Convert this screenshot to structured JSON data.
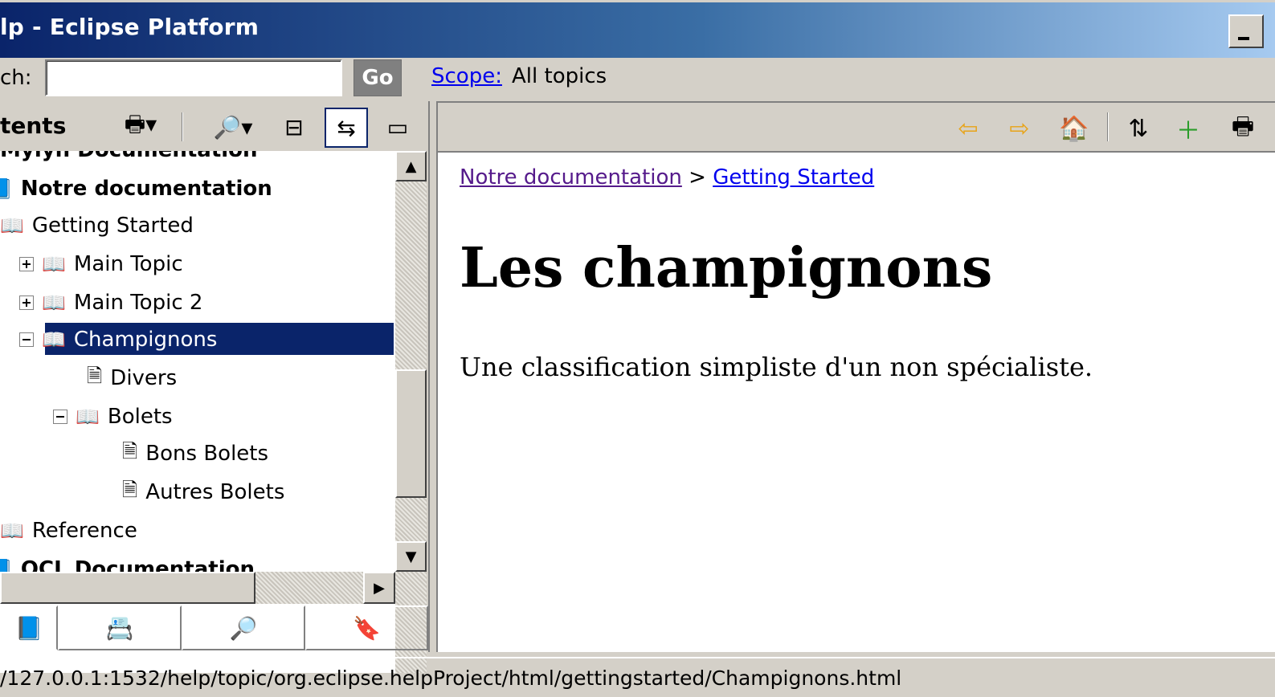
{
  "window": {
    "title": "lp - Eclipse Platform"
  },
  "search": {
    "label": "ch:",
    "value": "",
    "go_label": "Go",
    "scope_link": "Scope:",
    "scope_value": "All topics"
  },
  "contents": {
    "label": "tents",
    "tree": [
      {
        "label": "Notre documentation",
        "bold": true,
        "icon": "book-icon"
      },
      {
        "label": "Getting Started",
        "icon": "book-icon"
      },
      {
        "label": "Main Topic",
        "icon": "book-edit-icon",
        "expander": "plus"
      },
      {
        "label": "Main Topic 2",
        "icon": "book-icon",
        "expander": "plus"
      },
      {
        "label": "Champignons",
        "icon": "book-edit-icon",
        "expander": "minus",
        "selected": true
      },
      {
        "label": "Divers",
        "icon": "page-icon"
      },
      {
        "label": "Bolets",
        "icon": "book-edit-icon",
        "expander": "minus"
      },
      {
        "label": "Bons Bolets",
        "icon": "page-icon"
      },
      {
        "label": "Autres Bolets",
        "icon": "page-icon"
      },
      {
        "label": "Reference",
        "icon": "book-icon"
      },
      {
        "label": "OCL Documentation",
        "bold": true,
        "icon": "book-icon"
      }
    ]
  },
  "content": {
    "breadcrumb_1": "Notre documentation",
    "breadcrumb_sep": " > ",
    "breadcrumb_2": "Getting Started",
    "title": "Les champignons",
    "description": "Une classification simpliste d'un non spécialiste."
  },
  "status": {
    "url": "/127.0.0.1:1532/help/topic/org.eclipse.helpProject/html/gettingstarted/Champignons.html"
  }
}
